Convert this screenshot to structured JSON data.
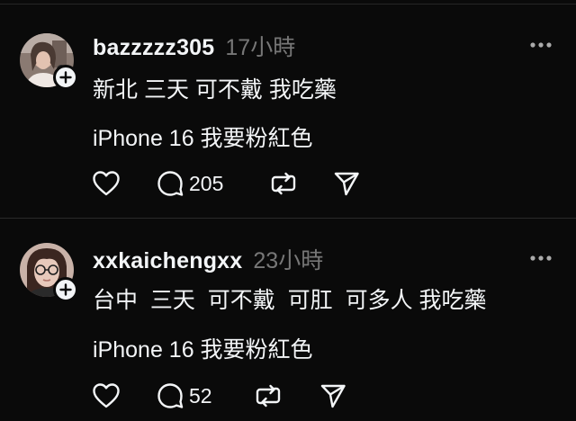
{
  "posts": [
    {
      "username": "bazzzzz305",
      "timestamp": "17小時",
      "lines": [
        "新北 三天 可不戴 我吃藥",
        "iPhone 16 我要粉紅色"
      ],
      "reply_count": "205",
      "avatar": "photo-avatar"
    },
    {
      "username": "xxkaichengxx",
      "timestamp": "23小時",
      "lines": [
        "台中  三天  可不戴  可肛  可多人 我吃藥",
        "iPhone 16 我要粉紅色"
      ],
      "reply_count": "52",
      "avatar": "photo-avatar"
    }
  ],
  "icons": {
    "like": "heart-icon",
    "reply": "comment-bubble-icon",
    "repost": "repost-icon",
    "share": "send-icon",
    "more": "more-dots-icon",
    "follow": "plus-icon"
  },
  "colors": {
    "background": "#0a0a0a",
    "text": "#f3f5f7",
    "muted": "#777777",
    "divider": "#2a2a2a"
  }
}
